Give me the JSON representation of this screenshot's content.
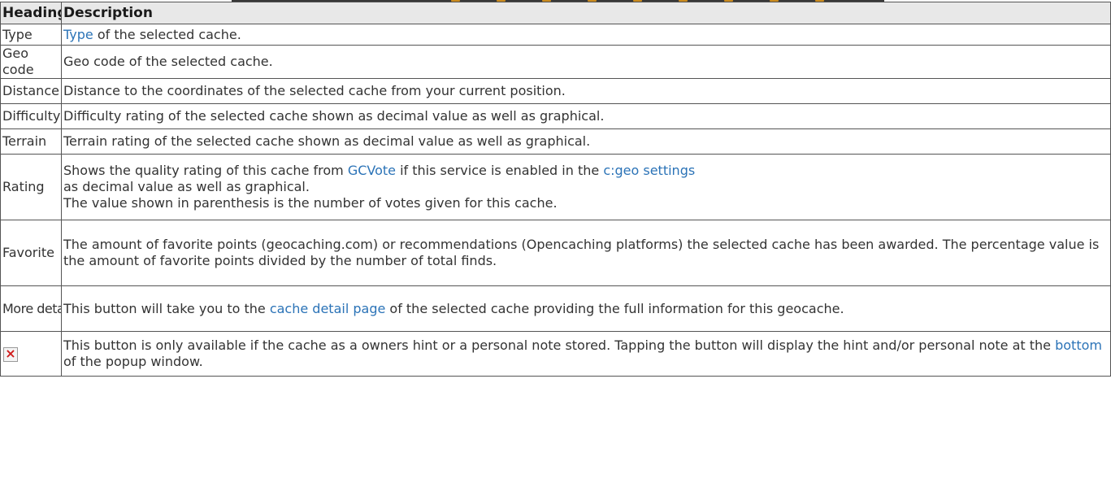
{
  "table": {
    "headers": {
      "heading": "Heading",
      "description": "Description"
    },
    "rows": {
      "type": {
        "heading": "Type",
        "link": "Type",
        "text": " of the selected cache."
      },
      "geo_code": {
        "heading": "Geo code",
        "text": "Geo code of the selected cache."
      },
      "distance": {
        "heading": "Distance",
        "text": "Distance to the coordinates of the selected cache from your current position."
      },
      "difficulty": {
        "heading": "Difficulty",
        "text": "Difficulty rating of the selected cache shown as decimal value as well as graphical."
      },
      "terrain": {
        "heading": "Terrain",
        "text": "Terrain rating of the selected cache shown as decimal value as well as graphical."
      },
      "rating": {
        "heading": "Rating",
        "text_1": "Shows the quality rating of this cache from ",
        "link_1": "GCVote",
        "text_2": " if this service is enabled in the ",
        "link_2": "c:geo settings",
        "text_3": "as decimal value as well as graphical.",
        "text_4": "The value shown in parenthesis is the number of votes given for this cache."
      },
      "favorite": {
        "heading": "Favorite",
        "text": "The amount of favorite points (geocaching.com) or recommendations (Opencaching platforms) the selected cache has been awarded. The percentage value is the amount of favorite points divided by the number of total finds."
      },
      "more_details": {
        "heading": "More details",
        "text_1": "This button will take you to the ",
        "link": "cache detail page",
        "text_2": " of the selected cache providing the full information for this geocache."
      },
      "hint": {
        "heading_icon": "broken-image-icon",
        "text_1": "This button is only available if the cache as a owners hint or a personal note stored. Tapping the button will display the hint and/or personal note at the ",
        "link": "bottom",
        "text_2": " of the popup window."
      }
    }
  },
  "colors": {
    "link": "#2b73b7",
    "border": "#555555",
    "header_background": "#e8e8e8",
    "text": "#333333",
    "broken_image_mark": "#d01a1a"
  }
}
